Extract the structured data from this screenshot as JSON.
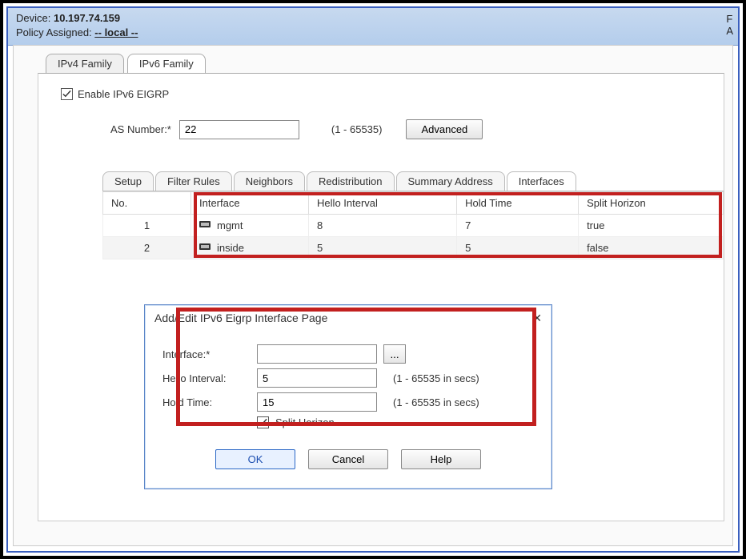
{
  "header": {
    "device_label": "Device:",
    "device_value": "10.197.74.159",
    "policy_label": "Policy Assigned:",
    "policy_value": "-- local --",
    "right_letter_1": "F",
    "right_letter_2": "A"
  },
  "tabs": {
    "ipv4": "IPv4 Family",
    "ipv6": "IPv6 Family"
  },
  "enable_label": "Enable IPv6 EIGRP",
  "as": {
    "label": "AS Number:*",
    "value": "22",
    "range": "(1 - 65535)",
    "advanced": "Advanced"
  },
  "subtabs": {
    "setup": "Setup",
    "filter": "Filter Rules",
    "neighbors": "Neighbors",
    "redistribution": "Redistribution",
    "summary": "Summary Address",
    "interfaces": "Interfaces"
  },
  "grid": {
    "headers": {
      "no": "No.",
      "interface": "Interface",
      "hello": "Hello Interval",
      "hold": "Hold Time",
      "split": "Split Horizon"
    },
    "rows": [
      {
        "no": "1",
        "iface": "mgmt",
        "hello": "8",
        "hold": "7",
        "split": "true"
      },
      {
        "no": "2",
        "iface": "inside",
        "hello": "5",
        "hold": "5",
        "split": "false"
      }
    ]
  },
  "dialog": {
    "title": "Add/Edit IPv6 Eigrp Interface Page",
    "close": "✕",
    "iface_label": "Interface:*",
    "iface_value": "",
    "browse": "...",
    "hello_label": "Hello Interval:",
    "hello_value": "5",
    "hold_label": "Hold Time:",
    "hold_value": "15",
    "range_hint": "(1 - 65535 in secs)",
    "split_label": "Split Horizon",
    "ok": "OK",
    "cancel": "Cancel",
    "help": "Help"
  }
}
